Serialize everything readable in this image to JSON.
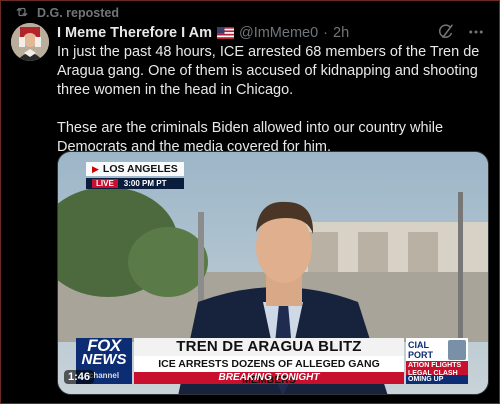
{
  "repost": {
    "label": "D.G. reposted",
    "icon": "repost-icon"
  },
  "author": {
    "name": "I Meme Therefore I Am",
    "flag_icon": "us-flag-icon",
    "handle": "@ImMeme0",
    "dot": "·",
    "time": "2h"
  },
  "actions": {
    "grok_icon": "grok-icon",
    "more_icon": "more-icon"
  },
  "post": {
    "paragraph1": "In just the past 48 hours, ICE arrested 68 members of the Tren de Aragua gang. One of them is accused of kidnapping and shooting three women in the head in Chicago.",
    "paragraph2": "These are the criminals Biden allowed into our country while Democrats and the media covered for him."
  },
  "media": {
    "location": "LOS ANGELES",
    "live": "LIVE",
    "live_time": "3:00 PM PT",
    "network_line1": "FOX",
    "network_line2": "NEWS",
    "network_line3": "channel",
    "headline": "TREN DE ARAGUA BLITZ",
    "subheadline": "ICE ARRESTS DOZENS OF ALLEGED GANG MEMBERS",
    "breaking": "BREAKING TONIGHT",
    "side_line1": "CIAL\nPORT",
    "side_line2": "ATION FLIGHTS\nLEGAL CLASH",
    "side_line3": "OMING UP",
    "duration": "1:46"
  },
  "colors": {
    "accent_red": "#c8102e",
    "fox_blue": "#0c2d73",
    "muted": "#71767b"
  }
}
